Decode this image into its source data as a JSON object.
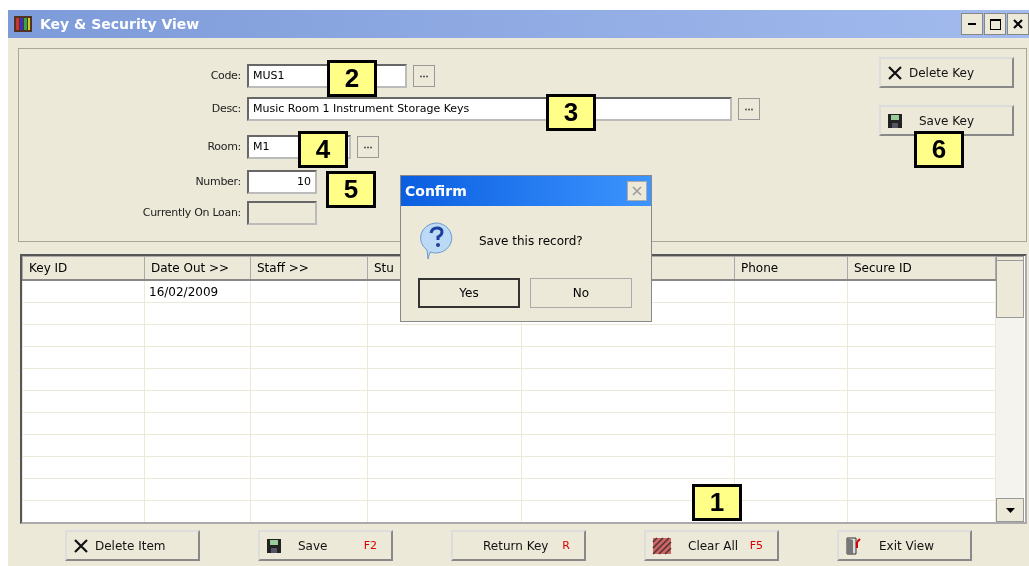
{
  "window": {
    "title": "Key & Security View"
  },
  "form": {
    "fields": [
      {
        "label": "Code:",
        "value": "MUS1",
        "kind": "lookup",
        "disabled": false
      },
      {
        "label": "Desc:",
        "value": "Music Room 1 Instrument Storage Keys",
        "kind": "lookup",
        "disabled": false
      },
      {
        "label": "Room:",
        "value": "M1",
        "kind": "lookup",
        "disabled": false
      },
      {
        "label": "Number:",
        "value": "10",
        "kind": "number",
        "disabled": false
      },
      {
        "label": "Currently On Loan:",
        "kind": "plain",
        "disabled": true
      }
    ]
  },
  "side_buttons": [
    {
      "label": "Delete Key",
      "kind": "delete"
    },
    {
      "label": "Save Key",
      "kind": "save"
    }
  ],
  "table": {
    "columns": [
      "Key ID",
      "Date Out >>",
      "Staff >>",
      "Stu",
      "",
      "Phone",
      "Secure ID"
    ],
    "rows": [
      {
        "cells": [
          "",
          "16/02/2009",
          "",
          "",
          "",
          "",
          ""
        ]
      }
    ]
  },
  "bottom_buttons": [
    {
      "label": "Delete Item",
      "kind": "delete"
    },
    {
      "label": "Save",
      "shortcut": "F2",
      "kind": "save"
    },
    {
      "label": "Return Key",
      "shortcut": "R",
      "kind": "plain"
    },
    {
      "label": "Clear All",
      "shortcut": "F5",
      "kind": "clear"
    },
    {
      "label": "Exit View",
      "kind": "exit"
    }
  ],
  "dialog": {
    "title": "Confirm",
    "message": "Save this record?",
    "buttons": [
      {
        "label": "Yes",
        "selected": true
      },
      {
        "label": "No",
        "selected": false
      }
    ]
  },
  "callouts": [
    "2",
    "3",
    "4",
    "5",
    "6",
    "1"
  ]
}
